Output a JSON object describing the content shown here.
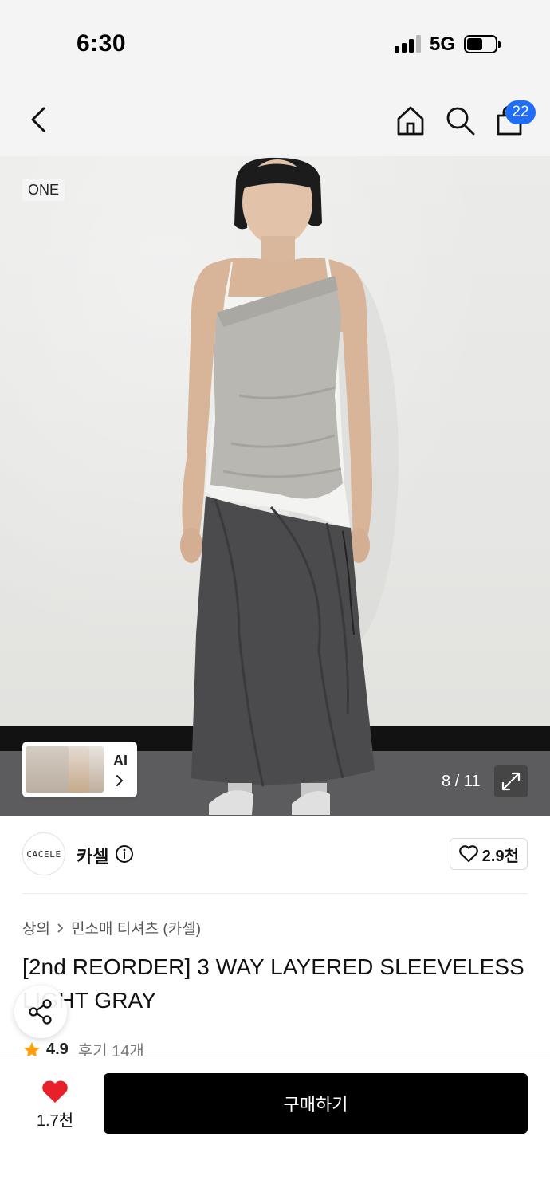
{
  "status_bar": {
    "time": "6:30",
    "network": "5G"
  },
  "nav": {
    "back_icon": "chevron-left-icon",
    "home_icon": "home-icon",
    "search_icon": "search-icon",
    "bag_icon": "shopping-bag-icon",
    "cart_count": "22"
  },
  "hero": {
    "tag": "ONE",
    "ai_label": "AI",
    "page_indicator": "8 / 11",
    "expand_icon": "expand-icon"
  },
  "brand": {
    "logo_text": "CACELE",
    "name": "카셀",
    "likes": "2.9천"
  },
  "breadcrumb": {
    "category": "상의",
    "subcategory": "민소매 티셔츠 (카셀)"
  },
  "product": {
    "title": "[2nd REORDER] 3 WAY LAYERED SLEEVELESS LIGHT GRAY",
    "rating": "4.9",
    "reviews": "후기 14개"
  },
  "bottom": {
    "wish_count": "1.7천",
    "buy_label": "구매하기"
  },
  "colors": {
    "accent_blue": "#1f6ef5",
    "heart_red": "#e8202a",
    "star_orange": "#ff9f0a"
  }
}
